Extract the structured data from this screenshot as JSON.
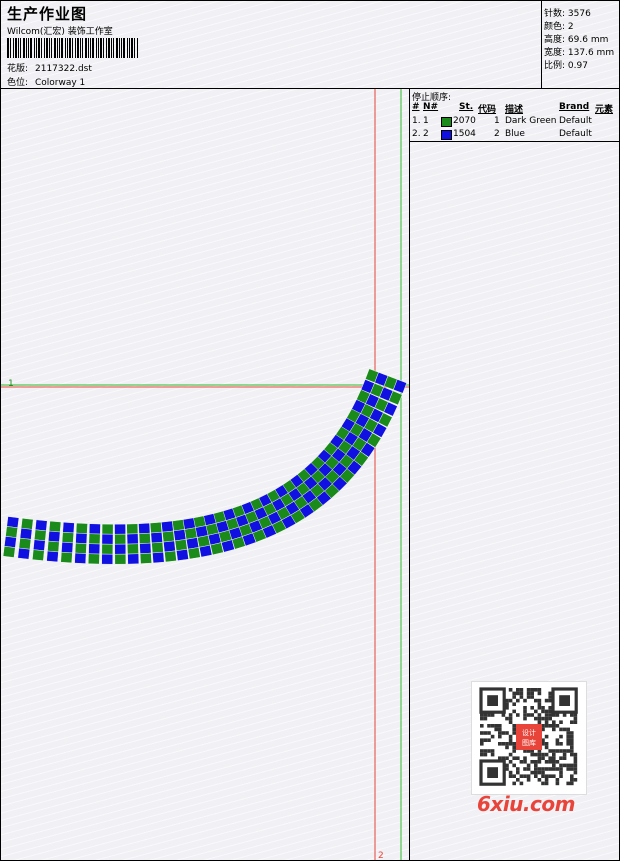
{
  "header": {
    "title": "生产作业图",
    "subtitle": "Wilcom(汇宏) 装饰工作室",
    "info": [
      {
        "label": "花版:",
        "value": "2117322.dst"
      },
      {
        "label": "色位:",
        "value": "Colorway 1"
      }
    ]
  },
  "stats": [
    {
      "label": "针数:",
      "value": "3576"
    },
    {
      "label": "颜色:",
      "value": "2"
    },
    {
      "label": "高度:",
      "value": "69.6 mm"
    },
    {
      "label": "宽度:",
      "value": "137.6 mm"
    },
    {
      "label": "比例:",
      "value": "0.97"
    }
  ],
  "stop_sequence": {
    "title": "停止顺序:",
    "columns": {
      "hash": "#",
      "no": "N#",
      "st": "St.",
      "code": "代码",
      "desc": "描述",
      "brand": "Brand",
      "elem": "元素"
    },
    "rows": [
      {
        "idx": "1.",
        "no": "1",
        "color": "#1a8a1a",
        "st": "2070",
        "code": "1",
        "desc": "Dark Green",
        "brand": "Default"
      },
      {
        "idx": "2.",
        "no": "2",
        "color": "#1010e0",
        "st": "1504",
        "code": "2",
        "desc": "Blue",
        "brand": "Default"
      }
    ]
  },
  "guides": {
    "h_label": "1",
    "v_label": "2"
  },
  "watermark": "6xiu.com",
  "qr_badge": [
    "设计",
    "图库"
  ]
}
